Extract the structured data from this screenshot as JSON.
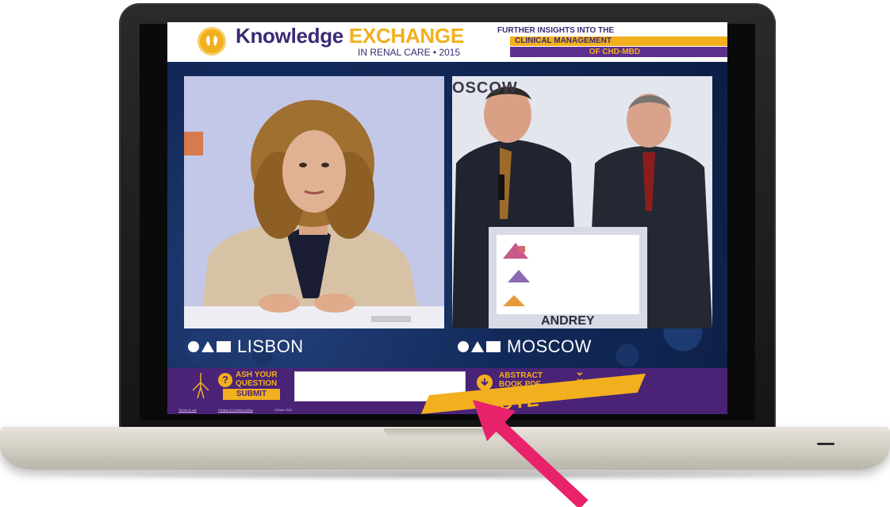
{
  "header": {
    "brand_knowledge": "Knowledge",
    "brand_exchange": "EXCHANGE",
    "brand_sub": "IN RENAL CARE • 2015",
    "further": "FURTHER INSIGHTS INTO THE",
    "clinical": "CLINICAL MANAGEMENT",
    "ckd": "OF CHD-MBD"
  },
  "video": {
    "left_city": "LISBON",
    "right_city": "MOSCOW",
    "right_sign": "OSCOW",
    "right_top_text": "...",
    "podium_name": "ANDREY"
  },
  "bottom_bar": {
    "ask_line1": "ASH YOUR",
    "ask_line2": "QUESTION",
    "submit_label": "SUBMIT",
    "question_value": "",
    "abstract_line1": "ABSTRACT",
    "abstract_line2": "BOOK PDF",
    "vote_label": "VOTE",
    "footer_terms": "Terms of use",
    "footer_privacy": "Privacy & Cookies policy",
    "footer_copy": "©Shire 2015"
  },
  "colors": {
    "purple": "#4a2377",
    "navy": "#3b2a73",
    "gold": "#f2b01e",
    "arrow": "#e8226b"
  }
}
